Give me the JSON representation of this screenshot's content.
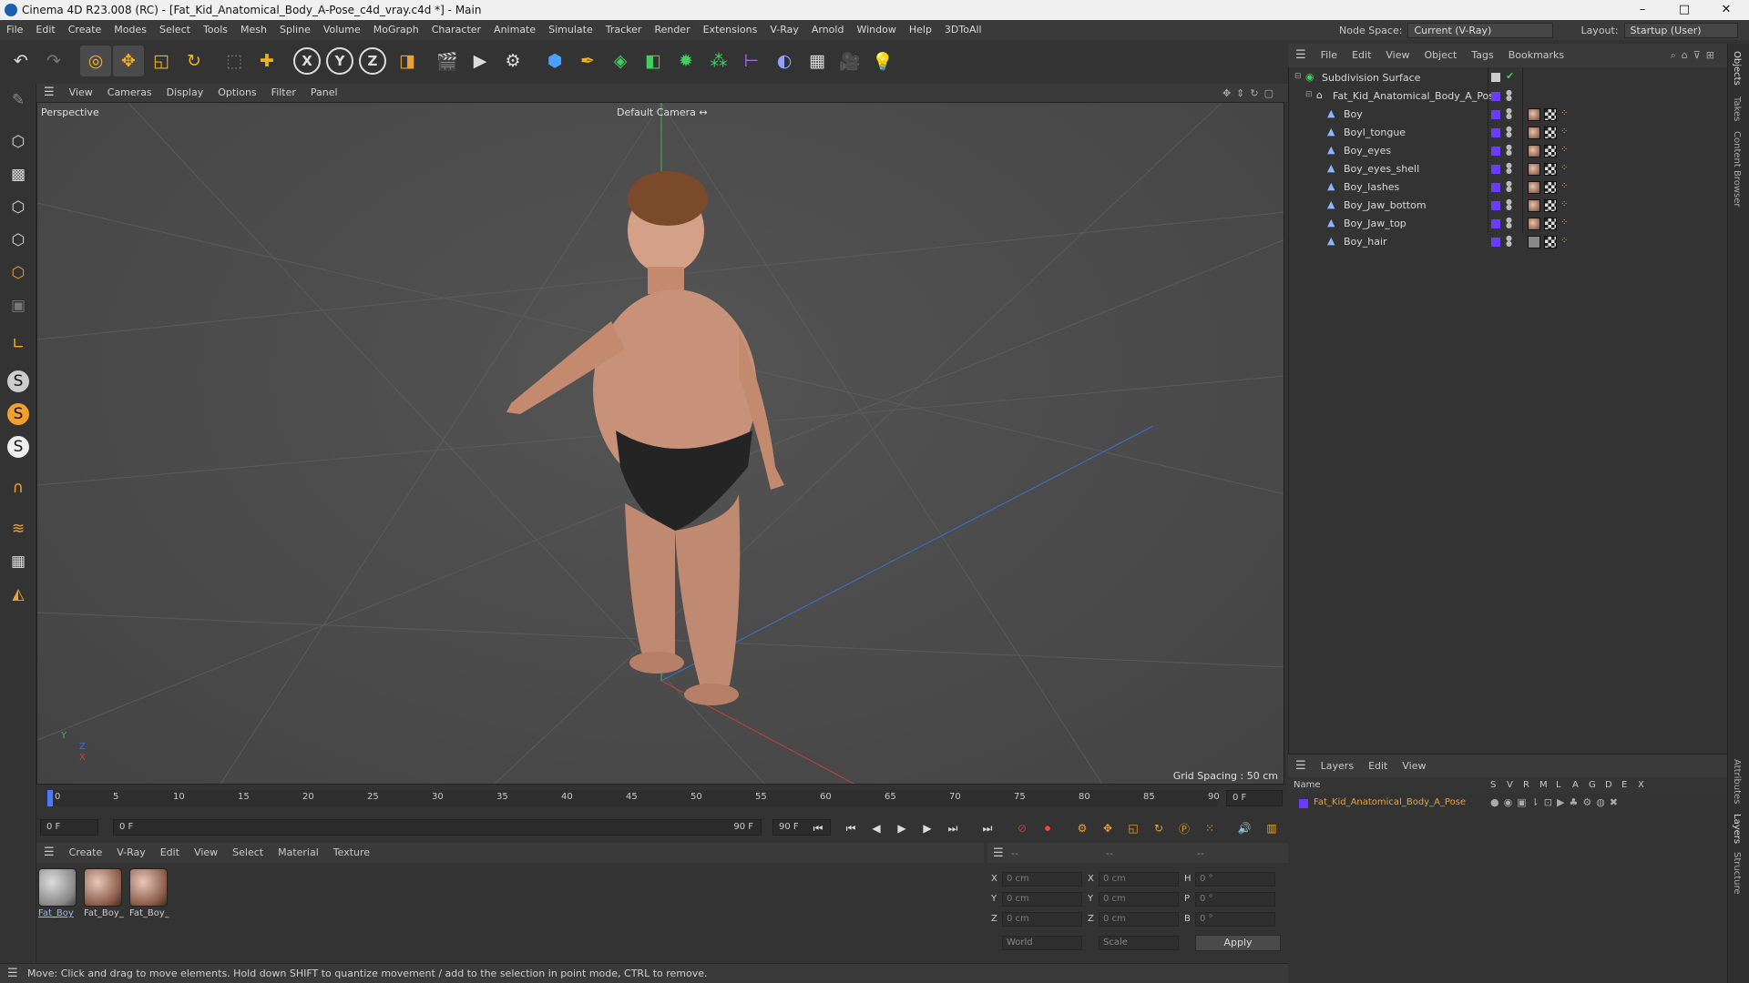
{
  "window": {
    "title": "Cinema 4D R23.008 (RC) - [Fat_Kid_Anatomical_Body_A-Pose_c4d_vray.c4d *] - Main",
    "minimize": "–",
    "maximize": "□",
    "close": "✕"
  },
  "menubar": {
    "items": [
      "File",
      "Edit",
      "Create",
      "Modes",
      "Select",
      "Tools",
      "Mesh",
      "Spline",
      "Volume",
      "MoGraph",
      "Character",
      "Animate",
      "Simulate",
      "Tracker",
      "Render",
      "Extensions",
      "V-Ray",
      "Arnold",
      "Window",
      "Help",
      "3DToAll"
    ],
    "node_space_label": "Node Space:",
    "node_space_value": "Current (V-Ray)",
    "layout_label": "Layout:",
    "layout_value": "Startup (User)"
  },
  "toolbar": {
    "axis_x": "X",
    "axis_y": "Y",
    "axis_z": "Z"
  },
  "viewport": {
    "menu": [
      "View",
      "Cameras",
      "Display",
      "Options",
      "Filter",
      "Panel"
    ],
    "view_name": "Perspective",
    "camera_name": "Default Camera",
    "grid_spacing": "Grid Spacing : 50 cm",
    "axis_y": "Y",
    "axis_z": "Z",
    "axis_x": "X"
  },
  "timeline": {
    "ticks": [
      "0",
      "5",
      "10",
      "15",
      "20",
      "25",
      "30",
      "35",
      "40",
      "45",
      "50",
      "55",
      "60",
      "65",
      "70",
      "75",
      "80",
      "85",
      "90"
    ],
    "current_frame_field": "0 F",
    "start_field": "0 F",
    "range_start": "0 F",
    "range_end": "90 F",
    "end_field": "90 F"
  },
  "material_manager": {
    "menu": [
      "Create",
      "V-Ray",
      "Edit",
      "View",
      "Select",
      "Material",
      "Texture"
    ],
    "materials": [
      "Fat_Boy",
      "Fat_Boy_",
      "Fat_Boy_"
    ]
  },
  "coordinates": {
    "header": [
      "--",
      "--",
      "--"
    ],
    "rows": [
      {
        "l1": "X",
        "v1": "0 cm",
        "l2": "X",
        "v2": "0 cm",
        "l3": "H",
        "v3": "0 °"
      },
      {
        "l1": "Y",
        "v1": "0 cm",
        "l2": "Y",
        "v2": "0 cm",
        "l3": "P",
        "v3": "0 °"
      },
      {
        "l1": "Z",
        "v1": "0 cm",
        "l2": "Z",
        "v2": "0 cm",
        "l3": "B",
        "v3": "0 °"
      }
    ],
    "space": "World",
    "mode": "Scale",
    "apply": "Apply"
  },
  "status": {
    "text": "Move: Click and drag to move elements. Hold down SHIFT to quantize movement / add to the selection in point mode, CTRL to remove."
  },
  "object_manager": {
    "menu": [
      "File",
      "Edit",
      "View",
      "Object",
      "Tags",
      "Bookmarks"
    ],
    "root": "Subdivision Surface",
    "group": "Fat_Kid_Anatomical_Body_A_Pose",
    "objects": [
      "Boy",
      "Boyl_tongue",
      "Boy_eyes",
      "Boy_eyes_shell",
      "Boy_lashes",
      "Boy_Jaw_bottom",
      "Boy_Jaw_top",
      "Boy_hair"
    ]
  },
  "layer_manager": {
    "menu": [
      "Layers",
      "Edit",
      "View"
    ],
    "col_name": "Name",
    "cols": [
      "S",
      "V",
      "R",
      "M",
      "L",
      "A",
      "G",
      "D",
      "E",
      "X"
    ],
    "layers": [
      "Fat_Kid_Anatomical_Body_A_Pose"
    ]
  },
  "right_tabs": [
    "Objects",
    "Takes",
    "Content Browser",
    "Attributes",
    "Layers",
    "Structure"
  ],
  "colors": {
    "accent": "#6a3cff",
    "layer_text": "#f0a030",
    "x_axis": "#c04040",
    "z_axis": "#3a70d0",
    "y_axis": "#40b060"
  }
}
